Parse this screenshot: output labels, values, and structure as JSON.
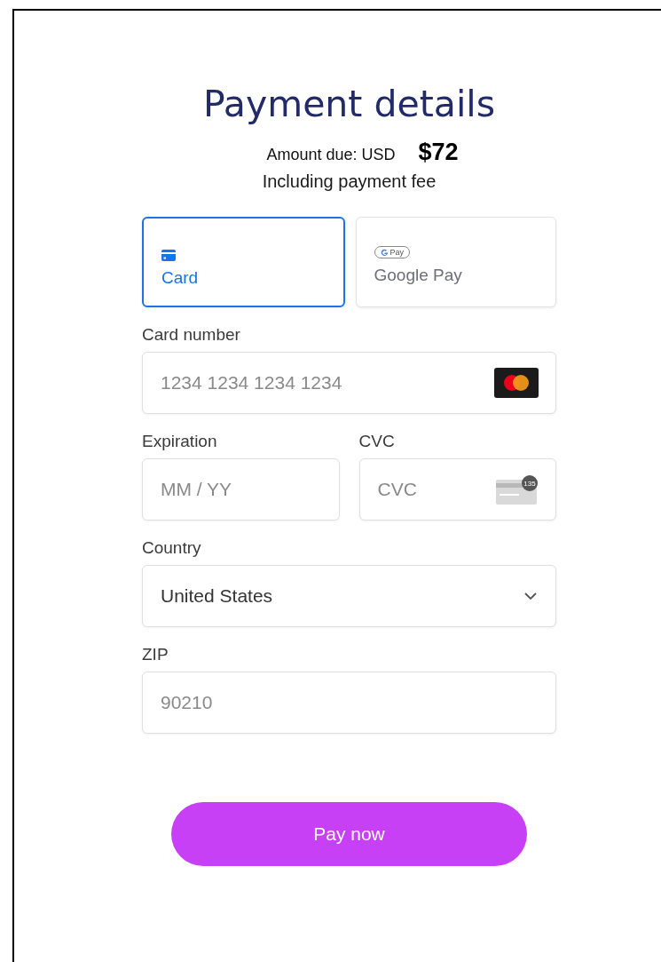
{
  "title": "Payment details",
  "amount": {
    "label": "Amount due: USD",
    "value": "$72"
  },
  "note": "Including payment fee",
  "methods": [
    {
      "kind": "card",
      "label": "Card",
      "selected": true
    },
    {
      "kind": "gpay",
      "label": "Google Pay",
      "badge": "Pay",
      "selected": false
    }
  ],
  "card_number": {
    "label": "Card number",
    "placeholder": "1234 1234 1234 1234"
  },
  "expiration": {
    "label": "Expiration",
    "placeholder": "MM / YY"
  },
  "cvc": {
    "label": "CVC",
    "placeholder": "CVC",
    "icon_text": "135"
  },
  "country": {
    "label": "Country",
    "value": "United States"
  },
  "zip": {
    "label": "ZIP",
    "placeholder": "90210"
  },
  "pay_button": "Pay now"
}
